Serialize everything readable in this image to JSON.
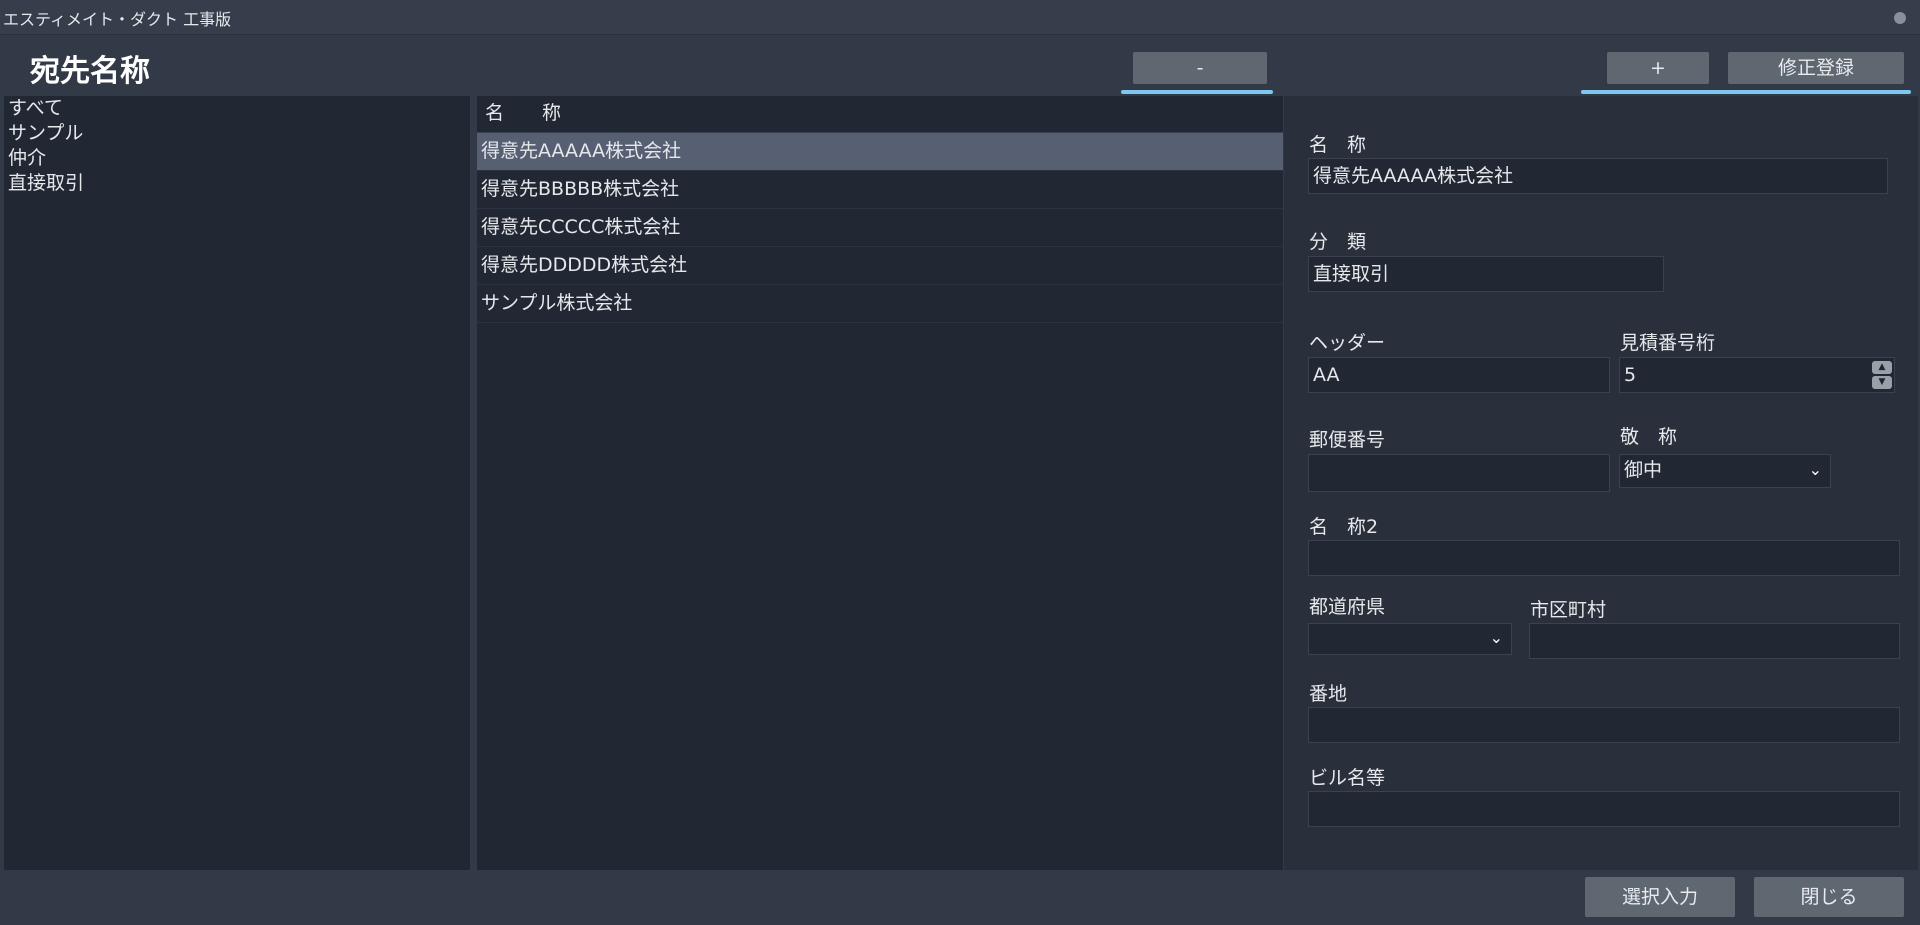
{
  "window": {
    "title": "エスティメイト・ダクト 工事版"
  },
  "page": {
    "title": "宛先名称"
  },
  "toolbar": {
    "minus_label": "-",
    "plus_label": "+",
    "update_label": "修正登録"
  },
  "categories": [
    "すべて",
    "サンプル",
    "仲介",
    "直接取引"
  ],
  "list": {
    "header": "名　　称",
    "rows": [
      {
        "name": "得意先AAAAA株式会社",
        "selected": true
      },
      {
        "name": "得意先BBBBB株式会社",
        "selected": false
      },
      {
        "name": "得意先CCCCC株式会社",
        "selected": false
      },
      {
        "name": "得意先DDDDD株式会社",
        "selected": false
      },
      {
        "name": "サンプル株式会社",
        "selected": false
      }
    ]
  },
  "detail": {
    "name_label": "名　称",
    "name_value": "得意先AAAAA株式会社",
    "category_label": "分　類",
    "category_value": "直接取引",
    "header_label": "ヘッダー",
    "header_value": "AA",
    "digits_label": "見積番号桁",
    "digits_value": "5",
    "postal_label": "郵便番号",
    "postal_value": "",
    "honorific_label": "敬　称",
    "honorific_value": "御中",
    "name2_label": "名　称2",
    "name2_value": "",
    "prefecture_label": "都道府県",
    "prefecture_value": "",
    "city_label": "市区町村",
    "city_value": "",
    "address_label": "番地",
    "address_value": "",
    "building_label": "ビル名等",
    "building_value": ""
  },
  "footer": {
    "select_label": "選択入力",
    "close_label": "閉じる"
  },
  "colors": {
    "accent": "#7ec8f0",
    "selected_row": "#575f73",
    "panel": "#212833"
  }
}
